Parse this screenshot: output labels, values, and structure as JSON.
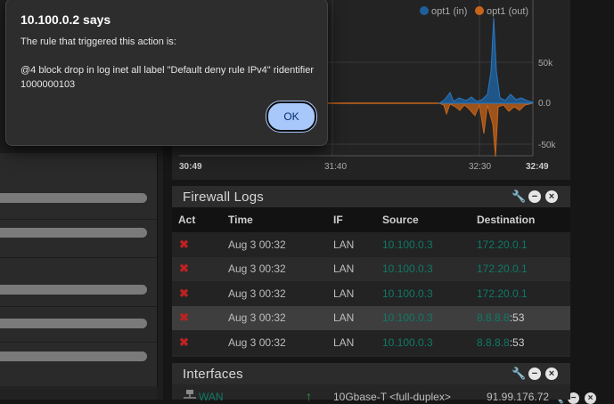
{
  "dialog": {
    "title": "10.100.0.2 says",
    "line1": "The rule that triggered this action is:",
    "line2": "@4 block drop in log inet all label \"Default deny rule IPv4\" ridentifier 1000000103",
    "ok_label": "OK"
  },
  "traffic_chart": {
    "legend": [
      {
        "name": "opt1 (in)",
        "color": "#1f5f99"
      },
      {
        "name": "opt1 (out)",
        "color": "#c8641a"
      }
    ],
    "y_ticks": [
      "50k",
      "0.0",
      "-50k"
    ],
    "x_ticks": [
      "30:49",
      "31:40",
      "32:30",
      "32:49"
    ]
  },
  "firewall_logs": {
    "title": "Firewall Logs",
    "columns": [
      "Act",
      "Time",
      "IF",
      "Source",
      "Destination"
    ],
    "rows": [
      {
        "act": "✖",
        "time": "Aug 3 00:32",
        "iface": "LAN",
        "source": "10.100.0.3",
        "dest": "172.20.0.1",
        "port": ""
      },
      {
        "act": "✖",
        "time": "Aug 3 00:32",
        "iface": "LAN",
        "source": "10.100.0.3",
        "dest": "172.20.0.1",
        "port": ""
      },
      {
        "act": "✖",
        "time": "Aug 3 00:32",
        "iface": "LAN",
        "source": "10.100.0.3",
        "dest": "172.20.0.1",
        "port": ""
      },
      {
        "act": "✖",
        "time": "Aug 3 00:32",
        "iface": "LAN",
        "source": "10.100.0.3",
        "dest": "8.8.8.8",
        "port": ":53"
      },
      {
        "act": "✖",
        "time": "Aug 3 00:32",
        "iface": "LAN",
        "source": "10.100.0.3",
        "dest": "8.8.8.8",
        "port": ":53"
      }
    ]
  },
  "interfaces": {
    "title": "Interfaces",
    "row": {
      "name": "WAN",
      "media": "10Gbase-T <full-duplex>",
      "ip": "91.99.176.72"
    }
  },
  "icons": {
    "wrench": "wrench-icon",
    "minimize": "minimize-icon",
    "close": "close-icon",
    "network": "network-icon",
    "up_arrow": "up-arrow-icon"
  }
}
